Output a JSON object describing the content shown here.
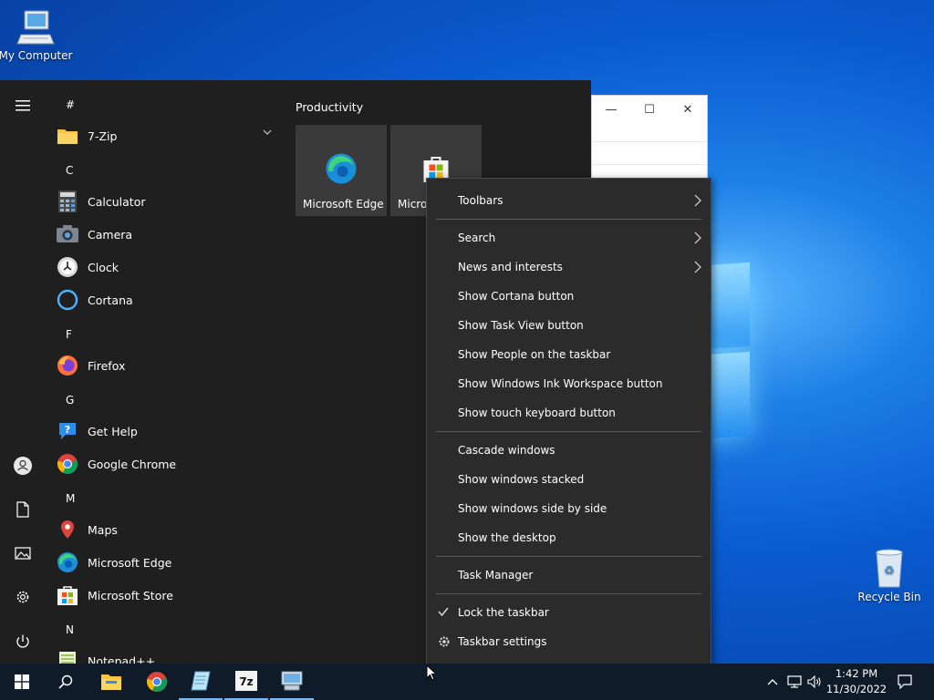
{
  "desktop": {
    "icons": [
      {
        "label": "My Computer"
      },
      {
        "label": "Recycle Bin"
      }
    ]
  },
  "start_menu": {
    "rail_icons": [
      "hamburger-menu-icon",
      "user-account-icon",
      "documents-icon",
      "pictures-icon",
      "settings-gear-icon",
      "power-icon"
    ],
    "groups": [
      {
        "letter": "#",
        "apps": [
          {
            "label": "7-Zip",
            "icon": "folder-icon"
          }
        ]
      },
      {
        "letter": "C",
        "apps": [
          {
            "label": "Calculator",
            "icon": "calculator-icon"
          },
          {
            "label": "Camera",
            "icon": "camera-icon"
          },
          {
            "label": "Clock",
            "icon": "clock-icon"
          },
          {
            "label": "Cortana",
            "icon": "cortana-icon"
          }
        ]
      },
      {
        "letter": "F",
        "apps": [
          {
            "label": "Firefox",
            "icon": "firefox-icon"
          }
        ]
      },
      {
        "letter": "G",
        "apps": [
          {
            "label": "Get Help",
            "icon": "get-help-icon"
          },
          {
            "label": "Google Chrome",
            "icon": "chrome-icon"
          }
        ]
      },
      {
        "letter": "M",
        "apps": [
          {
            "label": "Maps",
            "icon": "maps-icon"
          },
          {
            "label": "Microsoft Edge",
            "icon": "edge-icon"
          },
          {
            "label": "Microsoft Store",
            "icon": "store-icon"
          }
        ]
      },
      {
        "letter": "N",
        "apps": [
          {
            "label": "Notepad++",
            "icon": "notepad-plus-plus-icon"
          }
        ]
      }
    ],
    "tiles": {
      "heading": "Productivity",
      "items": [
        {
          "label": "Microsoft Edge",
          "icon": "edge-icon"
        },
        {
          "label": "Micro",
          "icon": "store-icon"
        }
      ]
    }
  },
  "context_menu": {
    "toolbars": "Toolbars",
    "search": "Search",
    "news": "News and interests",
    "cortana": "Show Cortana button",
    "task_view": "Show Task View button",
    "people": "Show People on the taskbar",
    "ink": "Show Windows Ink Workspace button",
    "touch_keyboard": "Show touch keyboard button",
    "cascade": "Cascade windows",
    "stacked": "Show windows stacked",
    "side_by_side": "Show windows side by side",
    "desktop": "Show the desktop",
    "task_manager": "Task Manager",
    "lock": "Lock the taskbar",
    "settings": "Taskbar settings"
  },
  "taskbar": {
    "apps": [
      "start-windows-icon",
      "search-icon",
      "file-explorer-icon",
      "chrome-icon",
      "notepad-icon",
      "7zip-icon",
      "system-properties-icon"
    ],
    "tray_icons": [
      "chevron-up-icon",
      "network-icon",
      "volume-icon",
      "notifications-icon"
    ],
    "time": "1:42 PM",
    "date": "11/30/2022"
  },
  "colors": {
    "menu_bg": "#1f1f1f",
    "context_bg": "#2b2b2b",
    "taskbar_bg": "#101b2a",
    "tile_bg": "#3a3a3a",
    "desktop_blue": "#0a5bd0"
  }
}
